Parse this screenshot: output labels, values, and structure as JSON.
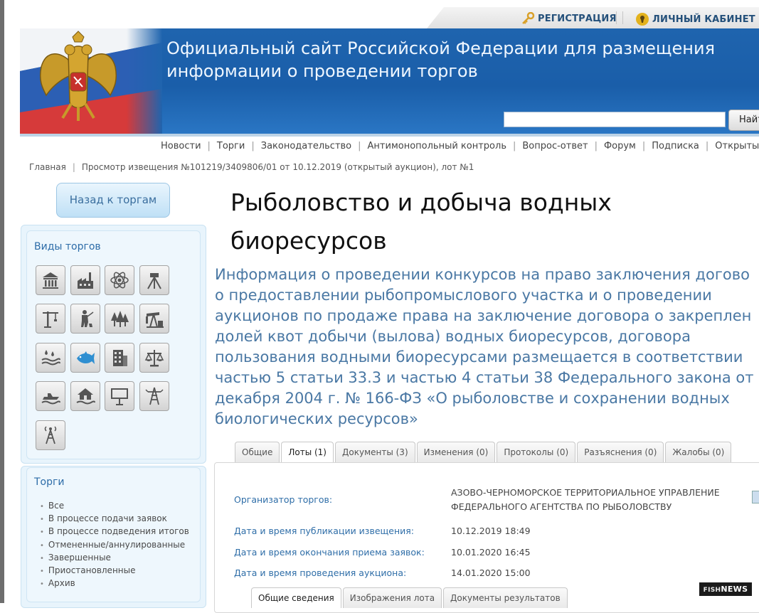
{
  "top_links": {
    "registration": "РЕГИСТРАЦИЯ",
    "cabinet": "ЛИЧНЫЙ КАБИНЕТ"
  },
  "header": {
    "title_line1": "Официальный сайт Российской Федерации для размещения",
    "title_line2": "информации о проведении торгов",
    "search_placeholder": "",
    "search_button": "Найт"
  },
  "nav": [
    "Новости",
    "Торги",
    "Законодательство",
    "Антимонопольный контроль",
    "Вопрос-ответ",
    "Форум",
    "Подписка",
    "Открытые данн"
  ],
  "breadcrumb": {
    "home": "Главная",
    "current": "Просмотр извещения №101219/3409806/01 от 10.12.2019 (открытый аукцион), лот №1"
  },
  "back_button": "Назад к торгам",
  "trade_types": {
    "title": "Виды торгов",
    "icons": [
      "government-building-icon",
      "factory-icon",
      "atom-icon",
      "surveyor-tripod-icon",
      "crane-icon",
      "hunter-icon",
      "forest-icon",
      "oil-pump-icon",
      "water-drops-icon",
      "fish-icon",
      "office-building-icon",
      "scales-icon",
      "jet-ski-icon",
      "house-flood-icon",
      "billboard-icon",
      "power-line-icon",
      "radio-tower-icon"
    ]
  },
  "trades": {
    "title": "Торги",
    "items": [
      "Все",
      "В процессе подачи заявок",
      "В процессе подведения итогов",
      "Отмененные/аннулированные",
      "Завершенные",
      "Приостановленные",
      "Архив"
    ]
  },
  "heading": {
    "line1": "Рыболовство и добыча водных",
    "line2": "биоресурсов"
  },
  "intro": [
    "Информация о проведении конкурсов на право заключения догово",
    "о предоставлении рыбопромыслового участка и о проведении",
    "аукционов по продаже права на заключение договора о закреплен",
    "долей квот добычи (вылова) водных биоресурсов, договора",
    "пользования водными биоресурсами размещается в соответствии",
    "частью 5 статьи 33.3 и частью 4 статьи 38 Федерального закона от",
    "декабря 2004 г. № 166-ФЗ «О рыболовстве и сохранении водных",
    "биологических ресурсов»"
  ],
  "tabs": [
    "Общие",
    "Лоты (1)",
    "Документы (3)",
    "Изменения (0)",
    "Протоколы (0)",
    "Разъяснения (0)",
    "Жалобы (0)"
  ],
  "active_tab": "Лоты (1)",
  "fields": {
    "organizer_label": "Организатор торгов:",
    "organizer_line1": "АЗОВО-ЧЕРНОМОРСКОЕ ТЕРРИТОРИАЛЬНОЕ УПРАВЛЕНИЕ",
    "organizer_line2": "ФЕДЕРАЛЬНОГО АГЕНТСТВА ПО РЫБОЛОВСТВУ",
    "published_label": "Дата и время публикации извещения:",
    "published_value": "10.12.2019 18:49",
    "deadline_label": "Дата и время окончания приема заявок:",
    "deadline_value": "10.01.2020 16:45",
    "auction_label": "Дата и время проведения аукциона:",
    "auction_value": "14.01.2020 15:00"
  },
  "subtabs": [
    "Общие сведения",
    "Изображения лота",
    "Документы результатов"
  ],
  "watermark": {
    "fish": "FISH",
    "news": "NEWS"
  }
}
